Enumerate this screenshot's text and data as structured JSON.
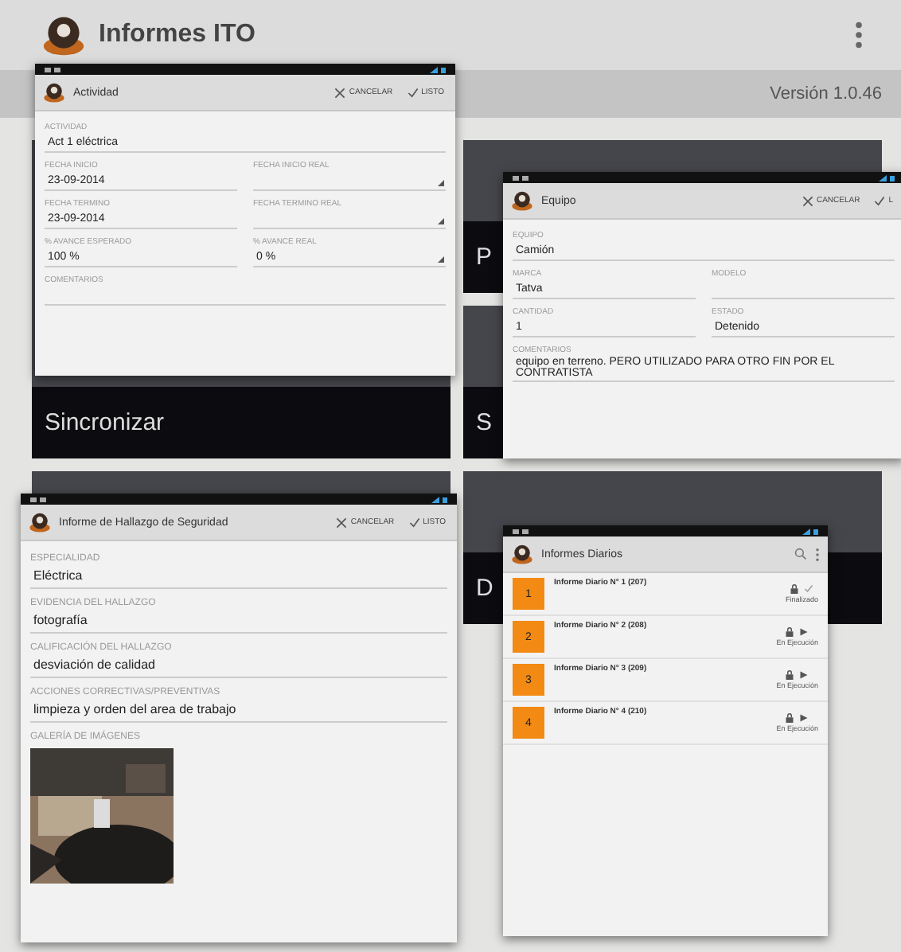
{
  "app": {
    "title": "Informes ITO",
    "version": "Versión 1.0.46"
  },
  "tiles": [
    {
      "label": "Sincronizar",
      "kind": "large"
    },
    {
      "label": "P",
      "kind": "small"
    },
    {
      "label": "S",
      "kind": "small"
    },
    {
      "kind": "large"
    },
    {
      "label": "D",
      "kind": "small"
    }
  ],
  "actividad": {
    "title": "Actividad",
    "cancel": "CANCELAR",
    "done": "LISTO",
    "rows": [
      [
        {
          "label": "ACTIVIDAD",
          "value": "Act 1 eléctrica"
        }
      ],
      [
        {
          "label": "FECHA INICIO",
          "value": "23-09-2014"
        },
        {
          "label": "FECHA INICIO REAL",
          "picker": true
        }
      ],
      [
        {
          "label": "FECHA TERMINO",
          "value": "23-09-2014"
        },
        {
          "label": "FECHA TERMINO REAL",
          "picker": true
        }
      ],
      [
        {
          "label": "% AVANCE ESPERADO",
          "value": "100 %"
        },
        {
          "label": "% AVANCE REAL",
          "value": "0 %",
          "picker": true
        }
      ],
      [
        {
          "label": "COMENTARIOS"
        }
      ]
    ]
  },
  "equipo": {
    "title": "Equipo",
    "cancel": "CANCELAR",
    "done": "L",
    "rows": [
      [
        {
          "label": "EQUIPO",
          "value": "Camión"
        }
      ],
      [
        {
          "label": "MARCA",
          "value": "Tatva"
        },
        {
          "label": "MODELO"
        }
      ],
      [
        {
          "label": "CANTIDAD",
          "value": "1"
        },
        {
          "label": "ESTADO",
          "value": "Detenido"
        }
      ],
      [
        {
          "label": "COMENTARIOS",
          "value": "equipo en terreno. PERO UTILIZADO PARA OTRO FIN POR EL CONTRATISTA"
        }
      ]
    ]
  },
  "hallazgo": {
    "title": "Informe de Hallazgo de Seguridad",
    "cancel": "CANCELAR",
    "done": "LISTO",
    "rows": [
      [
        {
          "label": "ESPECIALIDAD",
          "value": "Eléctrica"
        }
      ],
      [
        {
          "label": "EVIDENCIA DEL HALLAZGO",
          "value": "fotografía"
        }
      ],
      [
        {
          "label": "CALIFICACIÓN DEL HALLAZGO",
          "value": "desviación de calidad"
        }
      ],
      [
        {
          "label": "ACCIONES CORRECTIVAS/PREVENTIVAS",
          "value": "limpieza y orden del area de trabajo"
        }
      ]
    ],
    "gallery_label": "GALERÍA DE IMÁGENES",
    "gallery": [
      {
        "kind": "picture"
      }
    ]
  },
  "diarios": {
    "title": "Informes Diarios",
    "items": [
      {
        "number": "1",
        "title": "Informe Diario N° 1 (207)",
        "status": "Finalizado",
        "finished": true
      },
      {
        "number": "2",
        "title": "Informe Diario N° 2 (208)",
        "status": "En Ejecución",
        "finished": false
      },
      {
        "number": "3",
        "title": "Informe Diario N° 3 (209)",
        "status": "En Ejecución",
        "finished": false
      },
      {
        "number": "4",
        "title": "Informe Diario N° 4 (210)",
        "status": "En Ejecución",
        "finished": false
      }
    ]
  }
}
